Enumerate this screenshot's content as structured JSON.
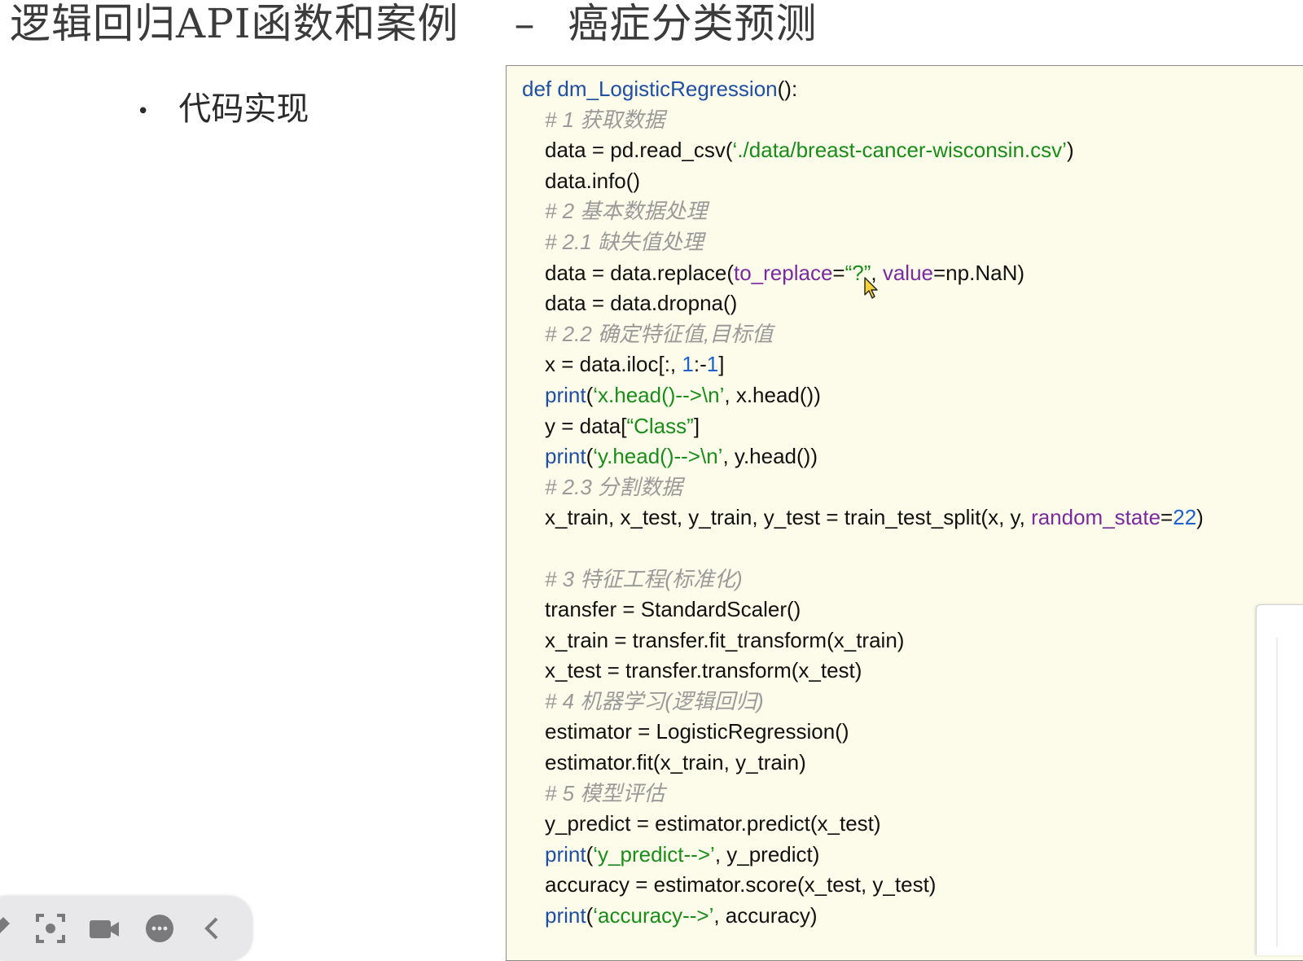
{
  "slide": {
    "title_left": "逻辑回归API函数和案例",
    "title_dash": "–",
    "title_right": "癌症分类预测",
    "bullet_symbol": "•",
    "bullet_text": "代码实现"
  },
  "code_lines": [
    {
      "indent": false,
      "tokens": [
        {
          "t": "kw",
          "v": "def "
        },
        {
          "t": "fn",
          "v": "dm_LogisticRegression"
        },
        {
          "t": "pl",
          "v": "():"
        }
      ]
    },
    {
      "indent": true,
      "tokens": [
        {
          "t": "cm",
          "v": "# 1 获取数据"
        }
      ]
    },
    {
      "indent": true,
      "tokens": [
        {
          "t": "pl",
          "v": "data = pd.read_csv("
        },
        {
          "t": "str",
          "v": "‘./data/breast-cancer-wisconsin.csv’"
        },
        {
          "t": "pl",
          "v": ")"
        }
      ]
    },
    {
      "indent": true,
      "tokens": [
        {
          "t": "pl",
          "v": "data.info()"
        }
      ]
    },
    {
      "indent": true,
      "tokens": [
        {
          "t": "cm",
          "v": "# 2 基本数据处理"
        }
      ]
    },
    {
      "indent": true,
      "tokens": [
        {
          "t": "cm",
          "v": "# 2.1 缺失值处理"
        }
      ]
    },
    {
      "indent": true,
      "tokens": [
        {
          "t": "pl",
          "v": "data = data.replace("
        },
        {
          "t": "arg",
          "v": "to_replace"
        },
        {
          "t": "pl",
          "v": "="
        },
        {
          "t": "str",
          "v": "“?”"
        },
        {
          "t": "pl",
          "v": ", "
        },
        {
          "t": "arg",
          "v": "value"
        },
        {
          "t": "pl",
          "v": "=np.NaN)"
        }
      ]
    },
    {
      "indent": true,
      "tokens": [
        {
          "t": "pl",
          "v": "data = data.dropna()"
        }
      ]
    },
    {
      "indent": true,
      "tokens": [
        {
          "t": "cm",
          "v": "# 2.2 确定特征值,目标值"
        }
      ]
    },
    {
      "indent": true,
      "tokens": [
        {
          "t": "pl",
          "v": "x = data.iloc[:, "
        },
        {
          "t": "num",
          "v": "1"
        },
        {
          "t": "pl",
          "v": ":-"
        },
        {
          "t": "num",
          "v": "1"
        },
        {
          "t": "pl",
          "v": "]"
        }
      ]
    },
    {
      "indent": true,
      "tokens": [
        {
          "t": "kw",
          "v": "print"
        },
        {
          "t": "pl",
          "v": "("
        },
        {
          "t": "str",
          "v": "‘x.head()-->\\n’"
        },
        {
          "t": "pl",
          "v": ", x.head())"
        }
      ]
    },
    {
      "indent": true,
      "tokens": [
        {
          "t": "pl",
          "v": "y = data["
        },
        {
          "t": "str",
          "v": "“Class”"
        },
        {
          "t": "pl",
          "v": "]"
        }
      ]
    },
    {
      "indent": true,
      "tokens": [
        {
          "t": "kw",
          "v": "print"
        },
        {
          "t": "pl",
          "v": "("
        },
        {
          "t": "str",
          "v": "‘y.head()-->\\n’"
        },
        {
          "t": "pl",
          "v": ", y.head())"
        }
      ]
    },
    {
      "indent": true,
      "tokens": [
        {
          "t": "cm",
          "v": "# 2.3 分割数据"
        }
      ]
    },
    {
      "indent": true,
      "tokens": [
        {
          "t": "pl",
          "v": "x_train, x_test, y_train, y_test = train_test_split(x, y, "
        },
        {
          "t": "arg",
          "v": "random_state"
        },
        {
          "t": "pl",
          "v": "="
        },
        {
          "t": "num",
          "v": "22"
        },
        {
          "t": "pl",
          "v": ")"
        }
      ]
    },
    {
      "indent": true,
      "tokens": []
    },
    {
      "indent": true,
      "tokens": [
        {
          "t": "cm",
          "v": "# 3 特征工程(标准化)"
        }
      ]
    },
    {
      "indent": true,
      "tokens": [
        {
          "t": "pl",
          "v": "transfer = StandardScaler()"
        }
      ]
    },
    {
      "indent": true,
      "tokens": [
        {
          "t": "pl",
          "v": "x_train = transfer.fit_transform(x_train)"
        }
      ]
    },
    {
      "indent": true,
      "tokens": [
        {
          "t": "pl",
          "v": "x_test = transfer.transform(x_test)"
        }
      ]
    },
    {
      "indent": true,
      "tokens": [
        {
          "t": "cm",
          "v": "# 4 机器学习(逻辑回归)"
        }
      ]
    },
    {
      "indent": true,
      "tokens": [
        {
          "t": "pl",
          "v": "estimator = LogisticRegression()"
        }
      ]
    },
    {
      "indent": true,
      "tokens": [
        {
          "t": "pl",
          "v": "estimator.fit(x_train, y_train)"
        }
      ]
    },
    {
      "indent": true,
      "tokens": [
        {
          "t": "cm",
          "v": "# 5 模型评估"
        }
      ]
    },
    {
      "indent": true,
      "tokens": [
        {
          "t": "pl",
          "v": "y_predict = estimator.predict(x_test)"
        }
      ]
    },
    {
      "indent": true,
      "tokens": [
        {
          "t": "kw",
          "v": "print"
        },
        {
          "t": "pl",
          "v": "("
        },
        {
          "t": "str",
          "v": "‘y_predict-->’"
        },
        {
          "t": "pl",
          "v": ", y_predict)"
        }
      ]
    },
    {
      "indent": true,
      "tokens": [
        {
          "t": "pl",
          "v": "accuracy = estimator.score(x_test, y_test)"
        }
      ]
    },
    {
      "indent": true,
      "tokens": [
        {
          "t": "kw",
          "v": "print"
        },
        {
          "t": "pl",
          "v": "("
        },
        {
          "t": "str",
          "v": "‘accuracy-->’"
        },
        {
          "t": "pl",
          "v": ", accuracy)"
        }
      ]
    }
  ],
  "colors": {
    "code_background": "#fdfcea",
    "keyword": "#1f4ea3",
    "string": "#1a8c1a",
    "argument": "#7a2a9e",
    "number": "#1e60d0",
    "comment": "#9a9a9a"
  },
  "toolbar_icons": [
    "pen-icon",
    "screenshot-icon",
    "camera-icon",
    "chat-icon",
    "collapse-icon"
  ]
}
